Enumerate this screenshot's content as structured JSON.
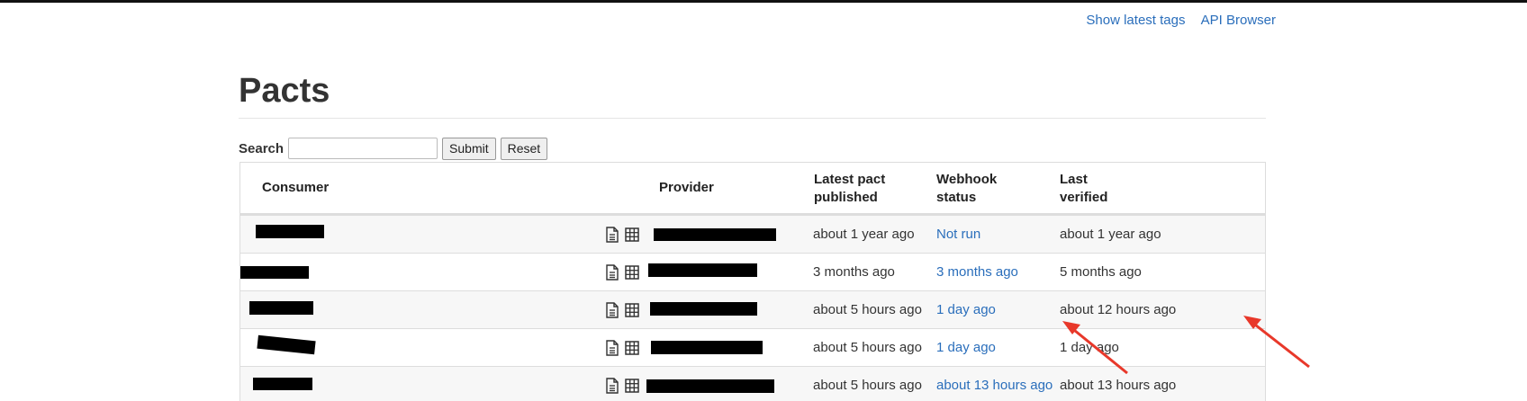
{
  "nav": {
    "latest_tags": "Show latest tags",
    "api_browser": "API Browser"
  },
  "page": {
    "title": "Pacts"
  },
  "search": {
    "label": "Search",
    "value": "",
    "placeholder": "",
    "submit": "Submit",
    "reset": "Reset"
  },
  "table": {
    "headers": {
      "consumer": "Consumer",
      "provider": "Provider",
      "latest_pact_line1": "Latest pact",
      "latest_pact_line2": "published",
      "webhook_line1": "Webhook",
      "webhook_line2": "status",
      "verified_line1": "Last",
      "verified_line2": "verified"
    },
    "rows": [
      {
        "published": "about 1 year ago",
        "webhook": "Not run",
        "verified": "about 1 year ago"
      },
      {
        "published": "3 months ago",
        "webhook": "3 months ago",
        "verified": "5 months ago"
      },
      {
        "published": "about 5 hours ago",
        "webhook": "1 day ago",
        "verified": "about 12 hours ago"
      },
      {
        "published": "about 5 hours ago",
        "webhook": "1 day ago",
        "verified": "1 day ago"
      },
      {
        "published": "about 5 hours ago",
        "webhook": "about 13 hours ago",
        "verified": "about 13 hours ago"
      }
    ]
  },
  "icons": {
    "pact_document": "document-icon",
    "pact_matrix": "grid-table-icon",
    "annotation": "red-arrow-icon"
  },
  "colors": {
    "link": "#2a6ebb",
    "annotation_arrow": "#e8382a"
  }
}
